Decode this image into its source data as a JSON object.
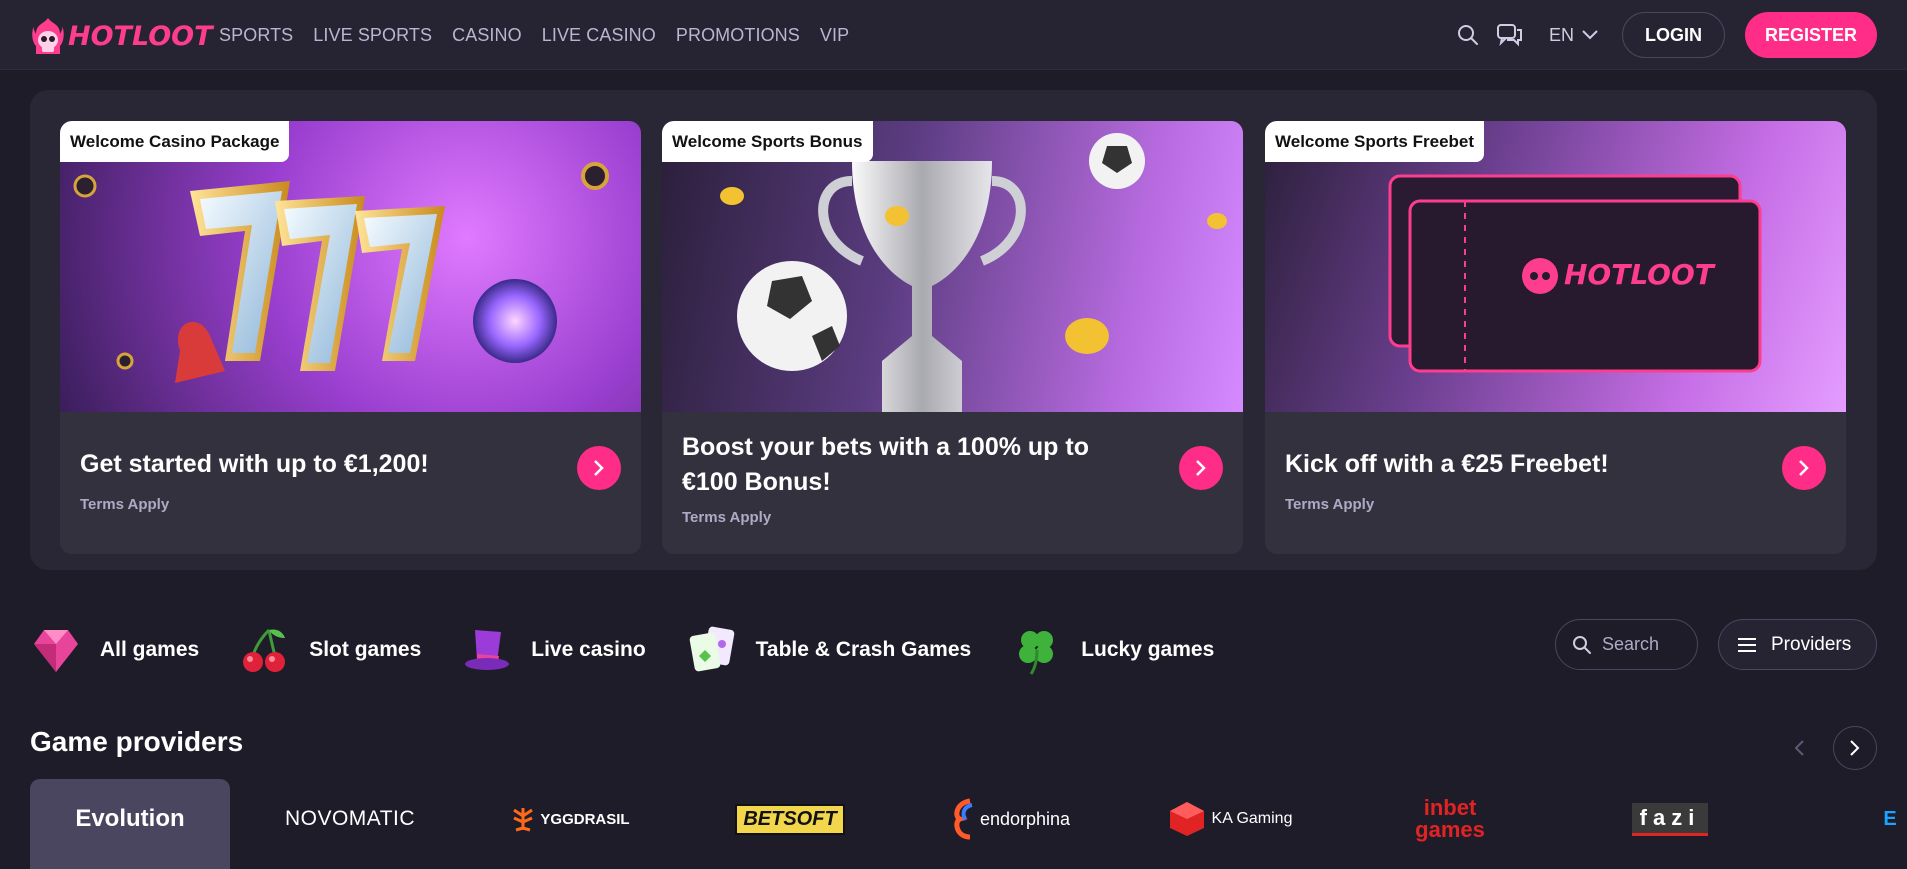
{
  "header": {
    "logo_text": "HOTLOOT",
    "nav": [
      "SPORTS",
      "LIVE SPORTS",
      "CASINO",
      "LIVE CASINO",
      "PROMOTIONS",
      "VIP"
    ],
    "language": "EN",
    "login_label": "LOGIN",
    "register_label": "REGISTER"
  },
  "promos": [
    {
      "tag": "Welcome Casino Package",
      "title": "Get started with up to €1,200!",
      "terms": "Terms Apply"
    },
    {
      "tag": "Welcome Sports Bonus",
      "title": "Boost your bets with a 100% up to €100 Bonus!",
      "terms": "Terms Apply"
    },
    {
      "tag": "Welcome Sports Freebet",
      "title": "Kick off with a €25 Freebet!",
      "terms": "Terms Apply",
      "image_logo_text": "HOTLOOT"
    }
  ],
  "categories": [
    {
      "label": "All games",
      "icon": "gem-icon"
    },
    {
      "label": "Slot games",
      "icon": "cherries-icon"
    },
    {
      "label": "Live casino",
      "icon": "top-hat-icon"
    },
    {
      "label": "Table & Crash Games",
      "icon": "cards-icon"
    },
    {
      "label": "Lucky games",
      "icon": "clover-icon"
    }
  ],
  "search": {
    "placeholder": "Search"
  },
  "providers_button": "Providers",
  "game_providers": {
    "title": "Game providers",
    "items": [
      {
        "name": "Evolution"
      },
      {
        "name": "NOVOMATIC"
      },
      {
        "name": "YGGDRASIL"
      },
      {
        "name": "BETSOFT"
      },
      {
        "name": "endorphina"
      },
      {
        "name": "KA Gaming"
      },
      {
        "name": "inbet games"
      },
      {
        "name": "fazi"
      },
      {
        "name": "E"
      }
    ]
  },
  "colors": {
    "accent": "#ff2d87",
    "background": "#1e1c28",
    "header": "#262433",
    "card": "#34313f"
  }
}
